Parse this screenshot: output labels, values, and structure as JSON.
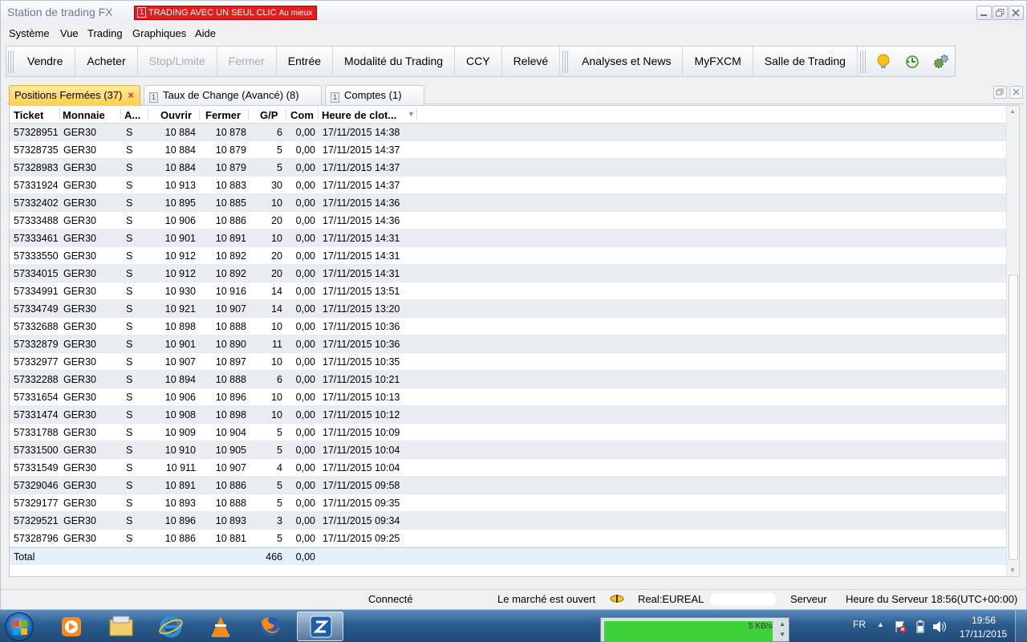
{
  "window": {
    "title": "Station de trading FX"
  },
  "one_click": {
    "num": "1",
    "label": "TRADING AVEC UN SEUL CLIC",
    "sub": "Au mieux"
  },
  "menu": [
    "Système",
    "Vue",
    "Trading",
    "Graphiques",
    "Aide"
  ],
  "toolbar": {
    "group1": [
      {
        "label": "Vendre",
        "enabled": true
      },
      {
        "label": "Acheter",
        "enabled": true
      },
      {
        "label": "Stop/Limite",
        "enabled": false
      },
      {
        "label": "Fermer",
        "enabled": false
      },
      {
        "label": "Entrée",
        "enabled": true
      },
      {
        "label": "Modalité du Trading",
        "enabled": true
      },
      {
        "label": "CCY",
        "enabled": true
      },
      {
        "label": "Relevé",
        "enabled": true
      }
    ],
    "group2": [
      {
        "label": "Analyses et News"
      },
      {
        "label": "MyFXCM"
      },
      {
        "label": "Salle de Trading"
      }
    ],
    "icons": [
      "lightbulb-icon",
      "clock-refresh-icon",
      "gears-icon"
    ]
  },
  "tabs": [
    {
      "label": "Positions Fermées (37)",
      "active": true,
      "icon": ""
    },
    {
      "label": "Taux de Change (Avancé) (8)",
      "active": false,
      "icon": "1"
    },
    {
      "label": "Comptes (1)",
      "active": false,
      "icon": "1"
    }
  ],
  "table": {
    "columns": [
      "Ticket",
      "Monnaie",
      "A...",
      "Ouvrir",
      "Fermer",
      "G/P",
      "Com",
      "Heure de clot..."
    ],
    "rows": [
      [
        "57328951",
        "GER30",
        "S",
        "10 884",
        "10 878",
        "6",
        "0,00",
        "17/11/2015 14:38"
      ],
      [
        "57328735",
        "GER30",
        "S",
        "10 884",
        "10 879",
        "5",
        "0,00",
        "17/11/2015 14:37"
      ],
      [
        "57328983",
        "GER30",
        "S",
        "10 884",
        "10 879",
        "5",
        "0,00",
        "17/11/2015 14:37"
      ],
      [
        "57331924",
        "GER30",
        "S",
        "10 913",
        "10 883",
        "30",
        "0,00",
        "17/11/2015 14:37"
      ],
      [
        "57332402",
        "GER30",
        "S",
        "10 895",
        "10 885",
        "10",
        "0,00",
        "17/11/2015 14:36"
      ],
      [
        "57333488",
        "GER30",
        "S",
        "10 906",
        "10 886",
        "20",
        "0,00",
        "17/11/2015 14:36"
      ],
      [
        "57333461",
        "GER30",
        "S",
        "10 901",
        "10 891",
        "10",
        "0,00",
        "17/11/2015 14:31"
      ],
      [
        "57333550",
        "GER30",
        "S",
        "10 912",
        "10 892",
        "20",
        "0,00",
        "17/11/2015 14:31"
      ],
      [
        "57334015",
        "GER30",
        "S",
        "10 912",
        "10 892",
        "20",
        "0,00",
        "17/11/2015 14:31"
      ],
      [
        "57334991",
        "GER30",
        "S",
        "10 930",
        "10 916",
        "14",
        "0,00",
        "17/11/2015 13:51"
      ],
      [
        "57334749",
        "GER30",
        "S",
        "10 921",
        "10 907",
        "14",
        "0,00",
        "17/11/2015 13:20"
      ],
      [
        "57332688",
        "GER30",
        "S",
        "10 898",
        "10 888",
        "10",
        "0,00",
        "17/11/2015 10:36"
      ],
      [
        "57332879",
        "GER30",
        "S",
        "10 901",
        "10 890",
        "11",
        "0,00",
        "17/11/2015 10:36"
      ],
      [
        "57332977",
        "GER30",
        "S",
        "10 907",
        "10 897",
        "10",
        "0,00",
        "17/11/2015 10:35"
      ],
      [
        "57332288",
        "GER30",
        "S",
        "10 894",
        "10 888",
        "6",
        "0,00",
        "17/11/2015 10:21"
      ],
      [
        "57331654",
        "GER30",
        "S",
        "10 906",
        "10 896",
        "10",
        "0,00",
        "17/11/2015 10:13"
      ],
      [
        "57331474",
        "GER30",
        "S",
        "10 908",
        "10 898",
        "10",
        "0,00",
        "17/11/2015 10:12"
      ],
      [
        "57331788",
        "GER30",
        "S",
        "10 909",
        "10 904",
        "5",
        "0,00",
        "17/11/2015 10:09"
      ],
      [
        "57331500",
        "GER30",
        "S",
        "10 910",
        "10 905",
        "5",
        "0,00",
        "17/11/2015 10:04"
      ],
      [
        "57331549",
        "GER30",
        "S",
        "10 911",
        "10 907",
        "4",
        "0,00",
        "17/11/2015 10:04"
      ],
      [
        "57329046",
        "GER30",
        "S",
        "10 891",
        "10 886",
        "5",
        "0,00",
        "17/11/2015 09:58"
      ],
      [
        "57329177",
        "GER30",
        "S",
        "10 893",
        "10 888",
        "5",
        "0,00",
        "17/11/2015 09:35"
      ],
      [
        "57329521",
        "GER30",
        "S",
        "10 896",
        "10 893",
        "3",
        "0,00",
        "17/11/2015 09:34"
      ],
      [
        "57328796",
        "GER30",
        "S",
        "10 886",
        "10 881",
        "5",
        "0,00",
        "17/11/2015 09:25"
      ]
    ],
    "total": {
      "label": "Total",
      "pl": "466",
      "com": "0,00"
    }
  },
  "status": {
    "connection": "Connecté",
    "market": "Le marché est ouvert",
    "account": "Real:EUREAL",
    "server": "Serveur",
    "server_time": "Heure du Serveur 18:56(UTC+00:00)"
  },
  "taskbar": {
    "apps": [
      "start-orb-icon",
      "media-player-icon",
      "explorer-folder-icon",
      "internet-explorer-icon",
      "vlc-icon",
      "firefox-icon",
      "trading-station-icon"
    ],
    "network_speed": "5 KB/s",
    "lang": "FR",
    "time": "19:56",
    "date": "17/11/2015"
  }
}
